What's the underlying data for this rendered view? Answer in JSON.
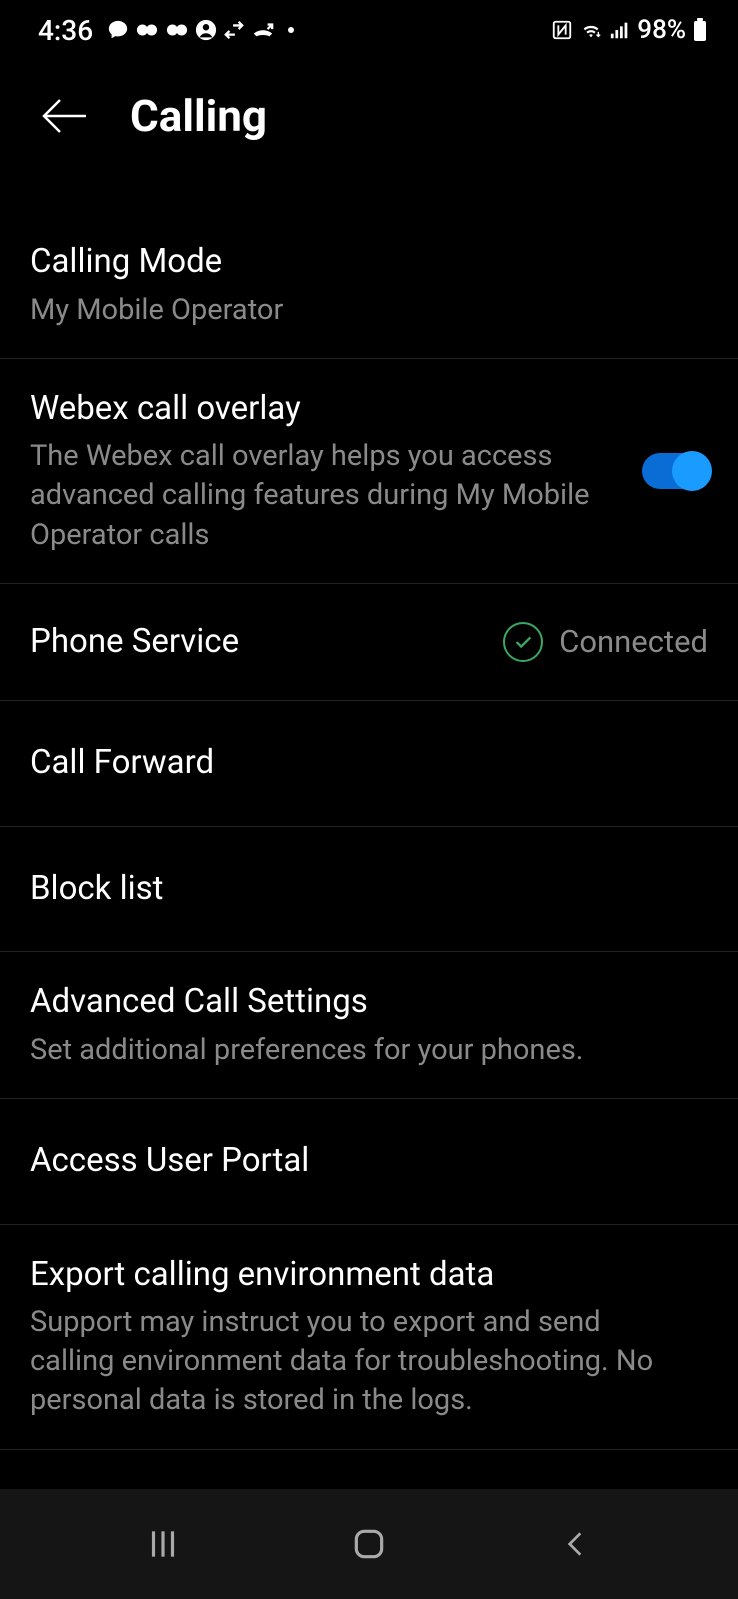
{
  "status_bar": {
    "time": "4:36",
    "battery": "98%"
  },
  "header": {
    "title": "Calling"
  },
  "settings": {
    "calling_mode": {
      "title": "Calling Mode",
      "subtitle": "My Mobile Operator"
    },
    "overlay": {
      "title": "Webex call overlay",
      "subtitle": "The Webex call overlay helps you access advanced calling features during My Mobile Operator calls",
      "enabled": true
    },
    "phone_service": {
      "title": "Phone Service",
      "status": "Connected"
    },
    "call_forward": {
      "title": "Call Forward"
    },
    "block_list": {
      "title": "Block list"
    },
    "advanced": {
      "title": "Advanced Call Settings",
      "subtitle": "Set additional preferences for your phones."
    },
    "user_portal": {
      "title": "Access User Portal"
    },
    "export": {
      "title": "Export calling environment data",
      "subtitle": "Support may instruct you to export and send calling environment data for troubleshooting. No personal data is stored in the logs."
    }
  }
}
